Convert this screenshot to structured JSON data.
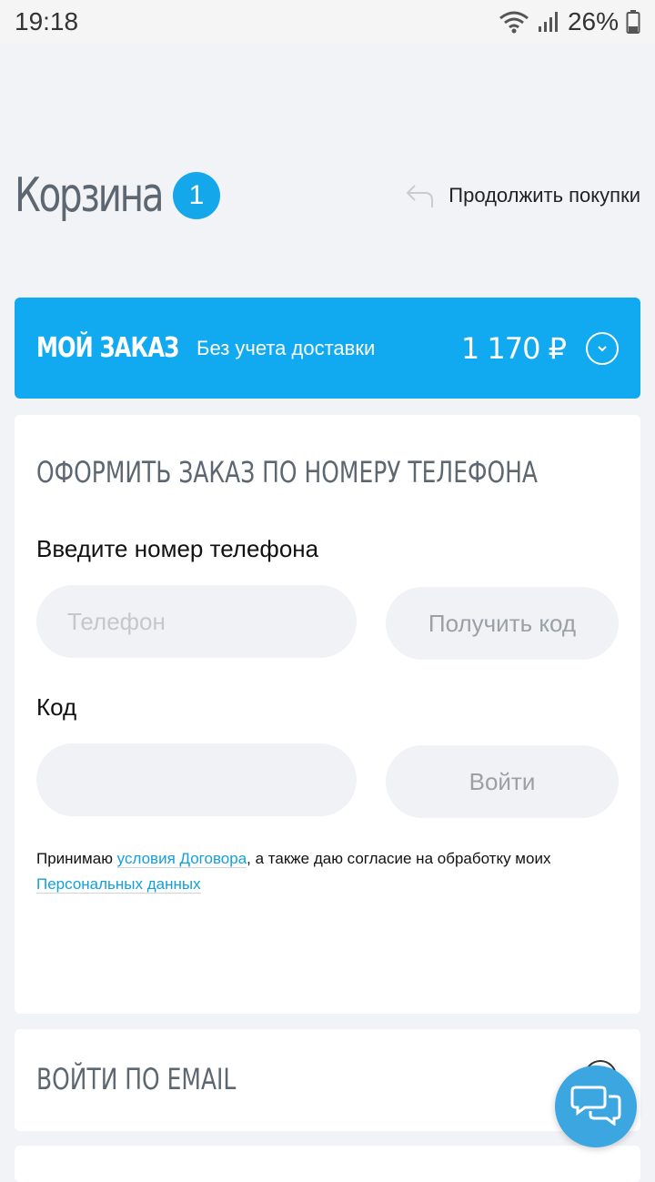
{
  "status_bar": {
    "time": "19:18",
    "battery": "26%",
    "icons": [
      "wifi-icon",
      "signal-icon",
      "battery-icon"
    ]
  },
  "header": {
    "title": "Корзина",
    "badge_count": "1",
    "continue_label": "Продолжить покупки",
    "continue_icon": "back-arrow-icon"
  },
  "order_bar": {
    "title": "МОЙ ЗАКАЗ",
    "subtitle": "Без учета доставки",
    "sum": "1 170 ₽",
    "toggle_icon": "chevron-down-icon"
  },
  "phone_section": {
    "title": "ОФОРМИТЬ ЗАКАЗ ПО НОМЕРУ ТЕЛЕФОНА",
    "phone_label": "Введите номер телефона",
    "phone_placeholder": "Телефон",
    "get_code_button": "Получить код",
    "code_label": "Код",
    "code_placeholder": "",
    "login_button": "Войти",
    "consent": {
      "text_before": "Принимаю ",
      "link1": "условия Договора",
      "text_middle": ", а также даю согласие на обработку моих ",
      "link2": "Персональных данных"
    }
  },
  "email_section": {
    "title": "ВОЙТИ ПО EMAIL"
  },
  "chat": {
    "icon": "chat-icon"
  },
  "colors": {
    "accent": "#11aaf0",
    "badge": "#14a8ea",
    "link": "#139fdd",
    "background": "#f1f3f6",
    "heading": "#5d6771"
  }
}
